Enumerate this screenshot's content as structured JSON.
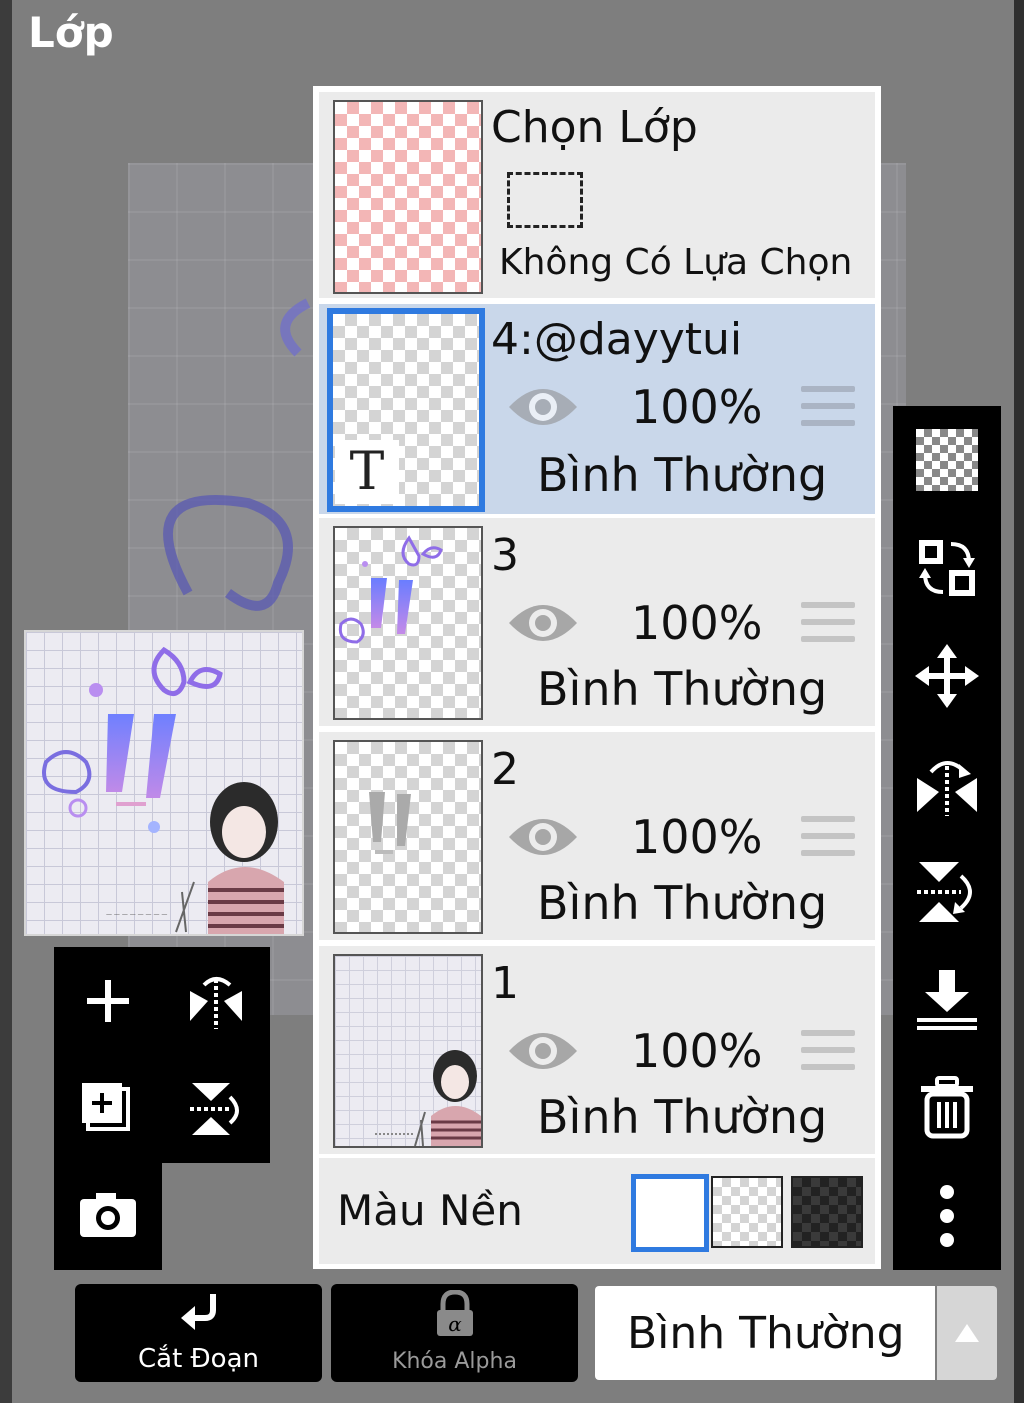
{
  "header": {
    "title": "Lớp"
  },
  "selection_layer": {
    "title": "Chọn Lớp",
    "status": "Không Có Lựa Chọn"
  },
  "layers": [
    {
      "name": "4:@dayytui",
      "opacity": "100%",
      "blend": "Bình Thường",
      "selected": true,
      "type_badge": "T"
    },
    {
      "name": "3",
      "opacity": "100%",
      "blend": "Bình Thường",
      "selected": false
    },
    {
      "name": "2",
      "opacity": "100%",
      "blend": "Bình Thường",
      "selected": false
    },
    {
      "name": "1",
      "opacity": "100%",
      "blend": "Bình Thường",
      "selected": false
    }
  ],
  "background": {
    "label": "Màu Nền",
    "options": [
      "white",
      "transparent",
      "dark-checker"
    ],
    "selected": "white"
  },
  "bottom_bar": {
    "clip_label": "Cắt Đoạn",
    "alpha_lock_label": "Khóa Alpha",
    "blend_mode": "Bình Thường"
  },
  "right_toolbar": [
    "transparency-icon",
    "swap-layer-icon",
    "move-icon",
    "flip-horizontal-icon",
    "flip-vertical-icon",
    "merge-down-icon",
    "trash-icon",
    "more-icon"
  ],
  "left_toolbar": [
    "add-layer-icon",
    "flip-horizontal-icon",
    "add-copy-layer-icon",
    "flip-vertical-icon",
    "camera-icon"
  ],
  "colors": {
    "accent": "#2f7ae0",
    "selected_row": "#c9d7ea",
    "toolbar": "#000000"
  }
}
